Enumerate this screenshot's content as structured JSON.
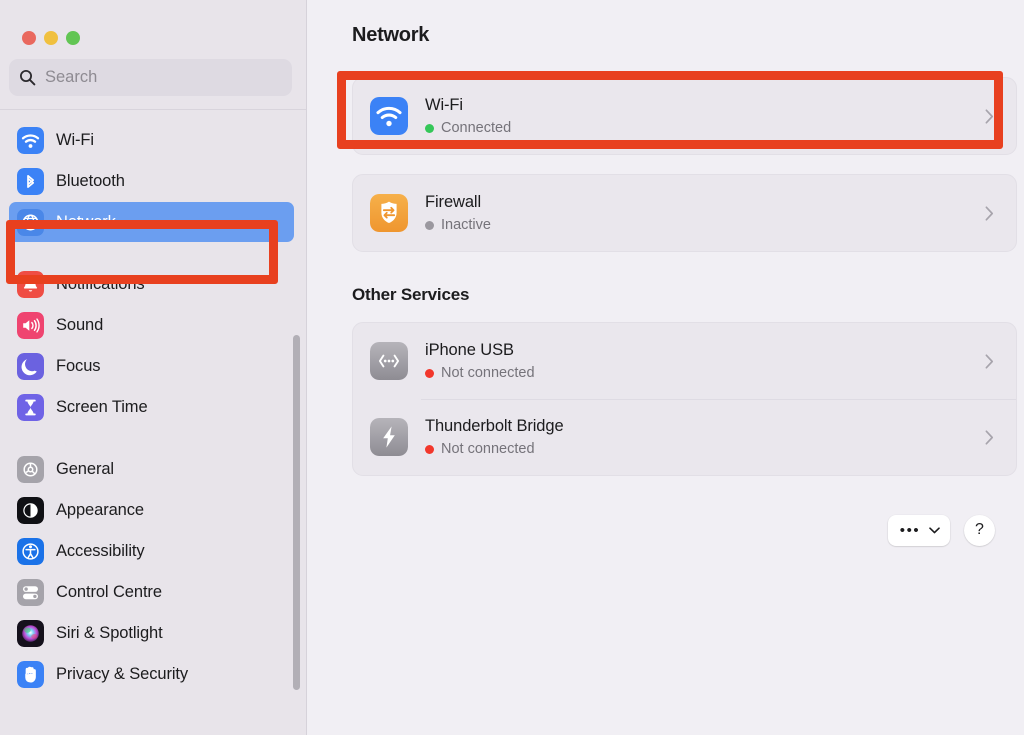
{
  "window": {
    "traffic_lights": [
      {
        "name": "close",
        "color": "#e9685e"
      },
      {
        "name": "minimize",
        "color": "#f0c03f"
      },
      {
        "name": "maximize",
        "color": "#62c554"
      }
    ]
  },
  "sidebar": {
    "search": {
      "placeholder": "Search",
      "value": "",
      "icon": "search-icon"
    },
    "selected_item": "Network",
    "groups": [
      {
        "items": [
          {
            "label": "Wi-Fi",
            "icon": "wifi-icon",
            "selected": false
          },
          {
            "label": "Bluetooth",
            "icon": "bluetooth-icon",
            "selected": false
          },
          {
            "label": "Network",
            "icon": "network-globe-icon",
            "selected": true
          }
        ]
      },
      {
        "items": [
          {
            "label": "Notifications",
            "icon": "notifications-bell-icon",
            "selected": false
          },
          {
            "label": "Sound",
            "icon": "sound-speaker-icon",
            "selected": false
          },
          {
            "label": "Focus",
            "icon": "focus-moon-icon",
            "selected": false
          },
          {
            "label": "Screen Time",
            "icon": "screen-time-hourglass-icon",
            "selected": false
          }
        ]
      },
      {
        "items": [
          {
            "label": "General",
            "icon": "general-gear-icon",
            "selected": false
          },
          {
            "label": "Appearance",
            "icon": "appearance-contrast-icon",
            "selected": false
          },
          {
            "label": "Accessibility",
            "icon": "accessibility-icon",
            "selected": false
          },
          {
            "label": "Control Centre",
            "icon": "control-centre-toggles-icon",
            "selected": false
          },
          {
            "label": "Siri & Spotlight",
            "icon": "siri-orb-icon",
            "selected": false
          },
          {
            "label": "Privacy & Security",
            "icon": "privacy-hand-icon",
            "selected": false
          }
        ]
      }
    ]
  },
  "main": {
    "title": "Network",
    "primary_rows": [
      {
        "title": "Wi-Fi",
        "status": "Connected",
        "status_color": "#35c759",
        "icon": "wifi-icon",
        "highlighted": true
      },
      {
        "title": "Firewall",
        "status": "Inactive",
        "status_color": "#9b989f",
        "icon": "firewall-shield-icon",
        "highlighted": false
      }
    ],
    "section_header": "Other Services",
    "service_rows": [
      {
        "title": "iPhone USB",
        "status": "Not connected",
        "status_color": "#f2372c",
        "icon": "iphone-usb-icon"
      },
      {
        "title": "Thunderbolt Bridge",
        "status": "Not connected",
        "status_color": "#f2372c",
        "icon": "thunderbolt-icon"
      }
    ],
    "footer": {
      "more_label": "•••",
      "more_icon": "chevron-down-icon",
      "help_label": "?"
    }
  },
  "annotations": {
    "accent_color": "#e8401f",
    "boxes": [
      {
        "target": "sidebar-item-network"
      },
      {
        "target": "wifi-row"
      }
    ]
  }
}
